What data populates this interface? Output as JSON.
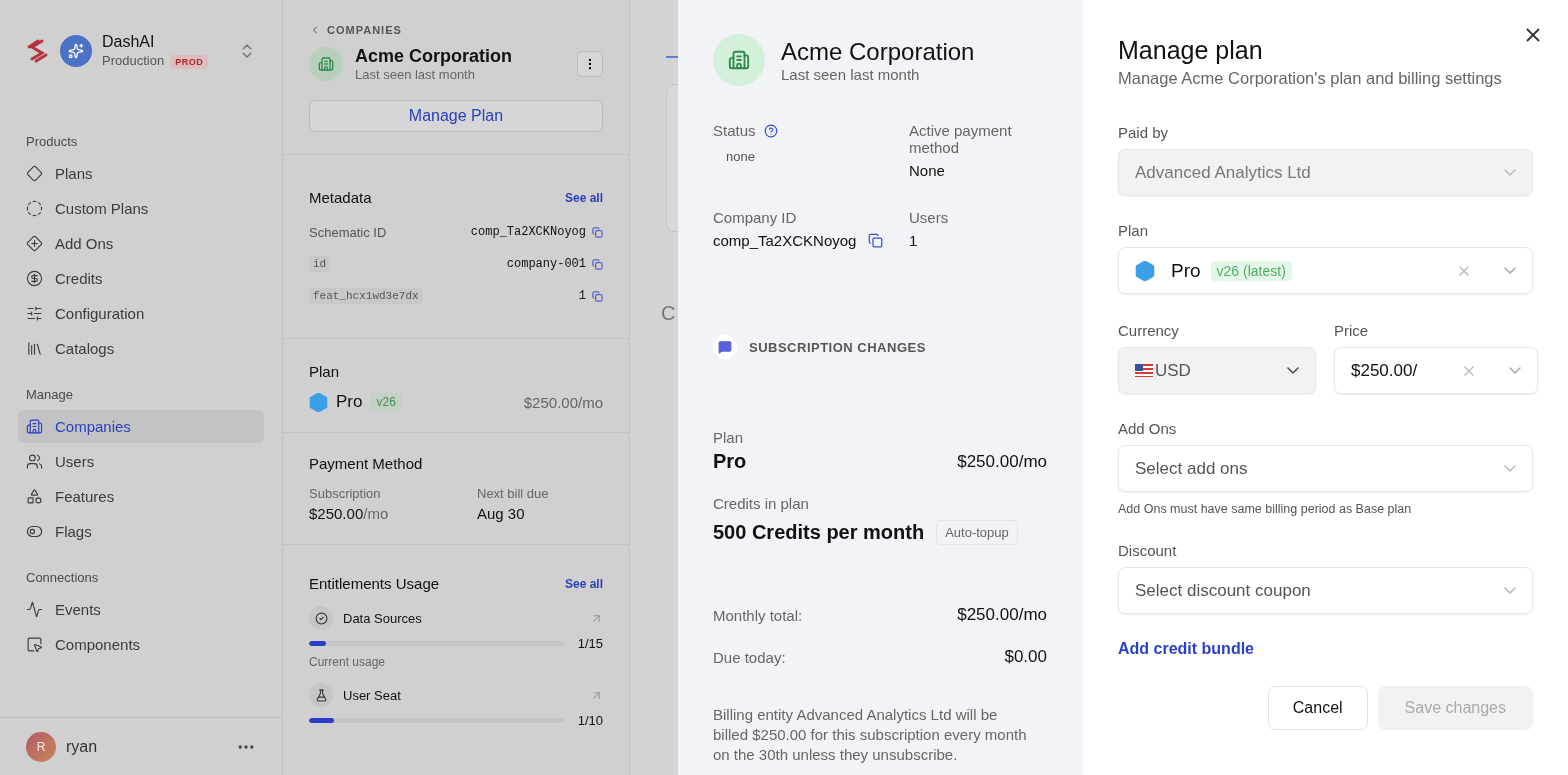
{
  "sidebar": {
    "workspace": {
      "name": "DashAI",
      "environment": "Production",
      "badge": "PROD"
    },
    "sections": [
      {
        "title": "Products",
        "items": [
          {
            "label": "Plans",
            "selected": false
          },
          {
            "label": "Custom Plans",
            "selected": false
          },
          {
            "label": "Add Ons",
            "selected": false
          },
          {
            "label": "Credits",
            "selected": false
          },
          {
            "label": "Configuration",
            "selected": false
          },
          {
            "label": "Catalogs",
            "selected": false
          }
        ]
      },
      {
        "title": "Manage",
        "items": [
          {
            "label": "Companies",
            "selected": true
          },
          {
            "label": "Users",
            "selected": false
          },
          {
            "label": "Features",
            "selected": false
          },
          {
            "label": "Flags",
            "selected": false
          }
        ]
      },
      {
        "title": "Connections",
        "items": [
          {
            "label": "Events",
            "selected": false
          },
          {
            "label": "Components",
            "selected": false
          }
        ]
      }
    ],
    "user": {
      "initial": "R",
      "name": "ryan"
    }
  },
  "company_panel": {
    "breadcrumb": "COMPANIES",
    "name": "Acme Corporation",
    "last_seen": "Last seen last month",
    "manage_button": "Manage Plan",
    "metadata": {
      "title": "Metadata",
      "see_all": "See all",
      "rows": [
        {
          "key": "Schematic ID",
          "kind": "label",
          "value": "comp_Ta2XCKNoyog"
        },
        {
          "key": "id",
          "kind": "code",
          "value": "company-001"
        },
        {
          "key": "feat_hcx1wd3e7dx",
          "kind": "code",
          "value": "1"
        }
      ]
    },
    "plan": {
      "title": "Plan",
      "name": "Pro",
      "version": "v26",
      "price": "$250.00/mo"
    },
    "payment": {
      "title": "Payment Method",
      "fields": [
        {
          "label": "Subscription",
          "value": "$250.00",
          "unit": "/mo"
        },
        {
          "label": "Next bill due",
          "value": "Aug 30"
        }
      ]
    },
    "entitlements": {
      "title": "Entitlements Usage",
      "see_all": "See all",
      "items": [
        {
          "name": "Data Sources",
          "usage": "1/15",
          "level": 0.067,
          "caption": "Current usage"
        },
        {
          "name": "User Seat",
          "usage": "1/10",
          "level": 0.1
        }
      ]
    }
  },
  "main": {
    "heading_fragment": "C"
  },
  "preview": {
    "name": "Acme Corporation",
    "last_seen": "Last seen last month",
    "details": [
      {
        "label": "Status",
        "kind": "status",
        "value": "none"
      },
      {
        "label": "Active payment method",
        "kind": "plain",
        "value": "None"
      },
      {
        "label": "Company ID",
        "kind": "copy",
        "value": "comp_Ta2XCKNoyog"
      },
      {
        "label": "Users",
        "kind": "plain",
        "value": "1"
      }
    ],
    "section_title": "SUBSCRIPTION CHANGES",
    "plan_label": "Plan",
    "plan_name": "Pro",
    "plan_price": "$250.00/mo",
    "credits_label": "Credits in plan",
    "credits_value": "500 Credits per month",
    "credits_badge": "Auto-topup",
    "totals": [
      {
        "label": "Monthly total:",
        "value": "$250.00/mo"
      },
      {
        "label": "Due today:",
        "value": "$0.00"
      }
    ],
    "note": "Billing entity Advanced Analytics Ltd will be billed $250.00 for this subscription every month on the 30th unless they unsubscribe."
  },
  "form": {
    "title": "Manage plan",
    "subtitle": "Manage Acme Corporation's plan and billing settings",
    "paid_by": {
      "label": "Paid by",
      "value": "Advanced Analytics Ltd",
      "disabled": true
    },
    "plan": {
      "label": "Plan",
      "value": "Pro",
      "tag": "v26 (latest)"
    },
    "currency": {
      "label": "Currency",
      "value": "USD",
      "disabled": true
    },
    "price": {
      "label": "Price",
      "value": "$250.00/"
    },
    "add_ons": {
      "label": "Add Ons",
      "placeholder": "Select add ons",
      "help": "Add Ons must have same billing period as Base plan"
    },
    "discount": {
      "label": "Discount",
      "placeholder": "Select discount coupon"
    },
    "link": "Add credit bundle",
    "buttons": [
      {
        "label": "Cancel",
        "disabled": false
      },
      {
        "label": "Save changes",
        "disabled": true
      }
    ]
  }
}
